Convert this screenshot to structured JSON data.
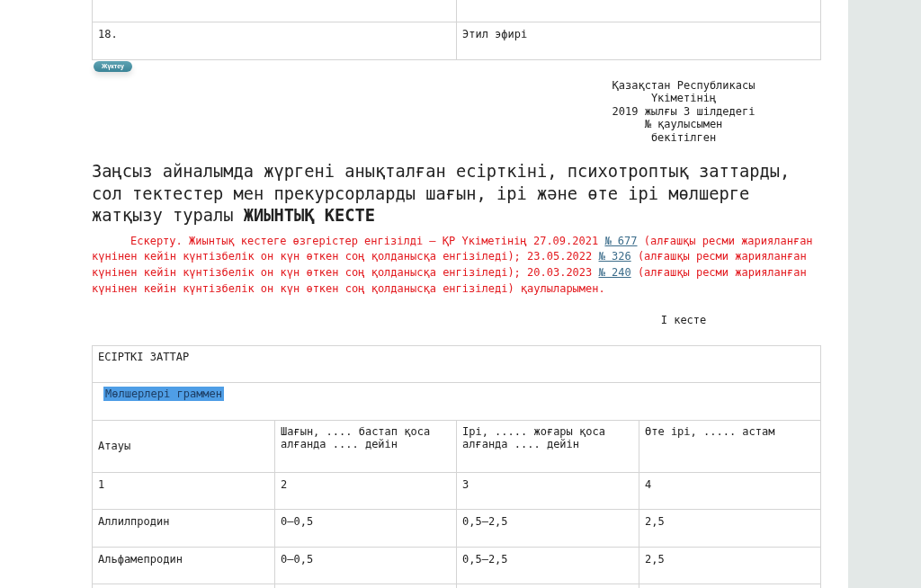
{
  "top_table": {
    "rows": [
      {
        "number": "18.",
        "name": "Этил эфирі"
      }
    ]
  },
  "upload_button": {
    "label": "Жүктеу"
  },
  "approval_note": {
    "lines": [
      "Қазақстан Республикасы",
      "Үкіметінің",
      "2019 жылғы 3 шілдедегі",
      "№ қаулысымен",
      "бекітілген"
    ]
  },
  "title": "Заңсыз айналымда жүргені анықталған есірткіні, психотроптық заттарды, сол тектестер мен прекурсорларды шағын, ірі және өте ірі мөлшерге жатқызу туралы **ЖИЫНТЫҚ КЕСТЕ**",
  "note": {
    "segments": [
      {
        "kind": "text",
        "text": "Ескерту. Жиынтық кестеге өзгерістер енгізілді – ҚР Үкіметінің 27.09.2021 "
      },
      {
        "kind": "link",
        "text": "№ 677"
      },
      {
        "kind": "text",
        "text": " (алғашқы ресми жарияланған күнінен кейін күнтізбелік он күн өткен соң қолданысқа енгізіледі); 23.05.2022 "
      },
      {
        "kind": "link",
        "text": "№ 326"
      },
      {
        "kind": "text",
        "text": " (алғашқы ресми жарияланған күнінен кейін күнтізбелік он күн өткен соң қолданысқа енгізіледі); 20.03.2023 "
      },
      {
        "kind": "link",
        "text": "№ 240"
      },
      {
        "kind": "text",
        "text": " (алғашқы ресми жарияланған күнінен кейін күнтізбелік он күн өткен соң қолданысқа енгізіледі) қаулыларымен."
      }
    ]
  },
  "table_label": "І кесте",
  "table": {
    "section": "ЕСІРТКІ ЗАТТАР",
    "units": {
      "text": "Мөлшерлері граммен",
      "highlighted": true
    },
    "columns": [
      "Атауы",
      "Шағын, .... бастап қоса алғанда .... дейін",
      "Ірі, ..... жоғары қоса алғанда .... дейін",
      "Өте ірі, ..... астам"
    ],
    "column_numbers": [
      "1",
      "2",
      "3",
      "4"
    ],
    "rows": [
      [
        "Аллилпродин",
        "0–0,5",
        "0,5–2,5",
        "2,5"
      ],
      [
        "Альфамепродин",
        "0–0,5",
        "0,5–2,5",
        "2,5"
      ]
    ]
  }
}
